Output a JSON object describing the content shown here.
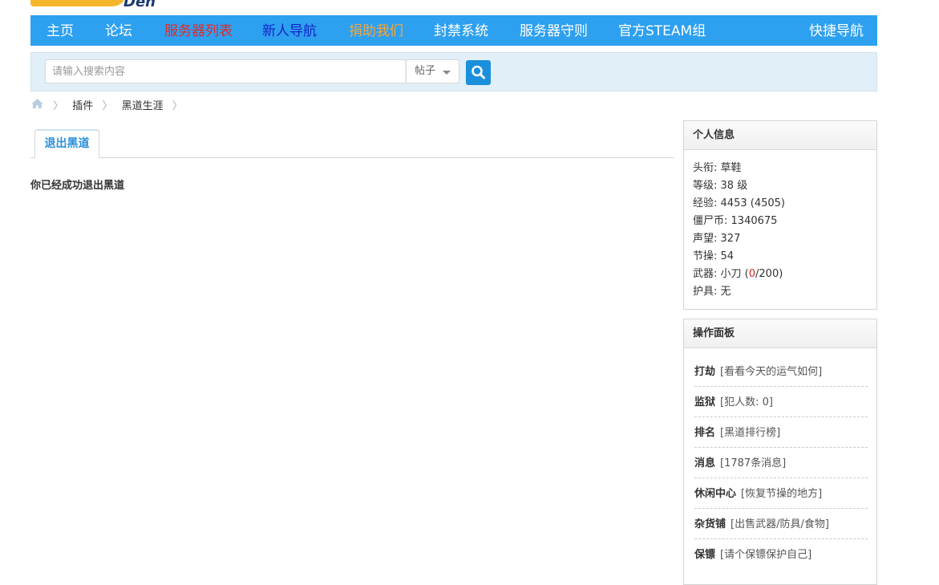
{
  "logo": {
    "text": "Den"
  },
  "nav": {
    "items": [
      {
        "label": "主页"
      },
      {
        "label": "论坛"
      },
      {
        "label": "服务器列表"
      },
      {
        "label": "新人导航"
      },
      {
        "label": "捐助我们"
      },
      {
        "label": "封禁系统"
      },
      {
        "label": "服务器守则"
      },
      {
        "label": "官方STEAM组"
      }
    ],
    "quick_nav": "快捷导航"
  },
  "search": {
    "placeholder": "请输入搜索内容",
    "type_value": "帖子"
  },
  "breadcrumb": {
    "items": [
      "插件",
      "黑道生涯"
    ],
    "separator": "〉"
  },
  "tabs": {
    "active_label": "退出黑道"
  },
  "main": {
    "message": "你已经成功退出黑道"
  },
  "profile_panel": {
    "title": "个人信息",
    "rows": [
      {
        "label": "头衔",
        "value": "草鞋"
      },
      {
        "label": "等级",
        "value": "38 级"
      },
      {
        "label": "经验",
        "value": "4453 (4505)"
      },
      {
        "label": "僵尸币",
        "value": "1340675"
      },
      {
        "label": "声望",
        "value": "327"
      },
      {
        "label": "节操",
        "value": "54"
      },
      {
        "label": "武器",
        "value_prefix": "小刀 (",
        "value_highlight": "0",
        "value_suffix": "/200)"
      },
      {
        "label": "护具",
        "value": "无"
      }
    ]
  },
  "ops_panel": {
    "title": "操作面板",
    "items": [
      {
        "label": "打劫",
        "desc": "[看看今天的运气如何]"
      },
      {
        "label": "监狱",
        "desc": "[犯人数: 0]"
      },
      {
        "label": "排名",
        "desc": "[黑道排行榜]"
      },
      {
        "label": "消息",
        "desc": "[1787条消息]"
      },
      {
        "label": "休闲中心",
        "desc": "[恢复节操的地方]"
      },
      {
        "label": "杂货铺",
        "desc": "[出售武器/防具/食物]"
      },
      {
        "label": "保镖",
        "desc": "[请个保镖保护自己]"
      }
    ]
  },
  "colors": {
    "nav_bg": "#2ea0f0",
    "nav_red": "#e02a2a",
    "nav_blue": "#1424c8",
    "nav_orange": "#f5a63a",
    "search_bg": "#e1eff8",
    "accent": "#2b8fd9"
  }
}
